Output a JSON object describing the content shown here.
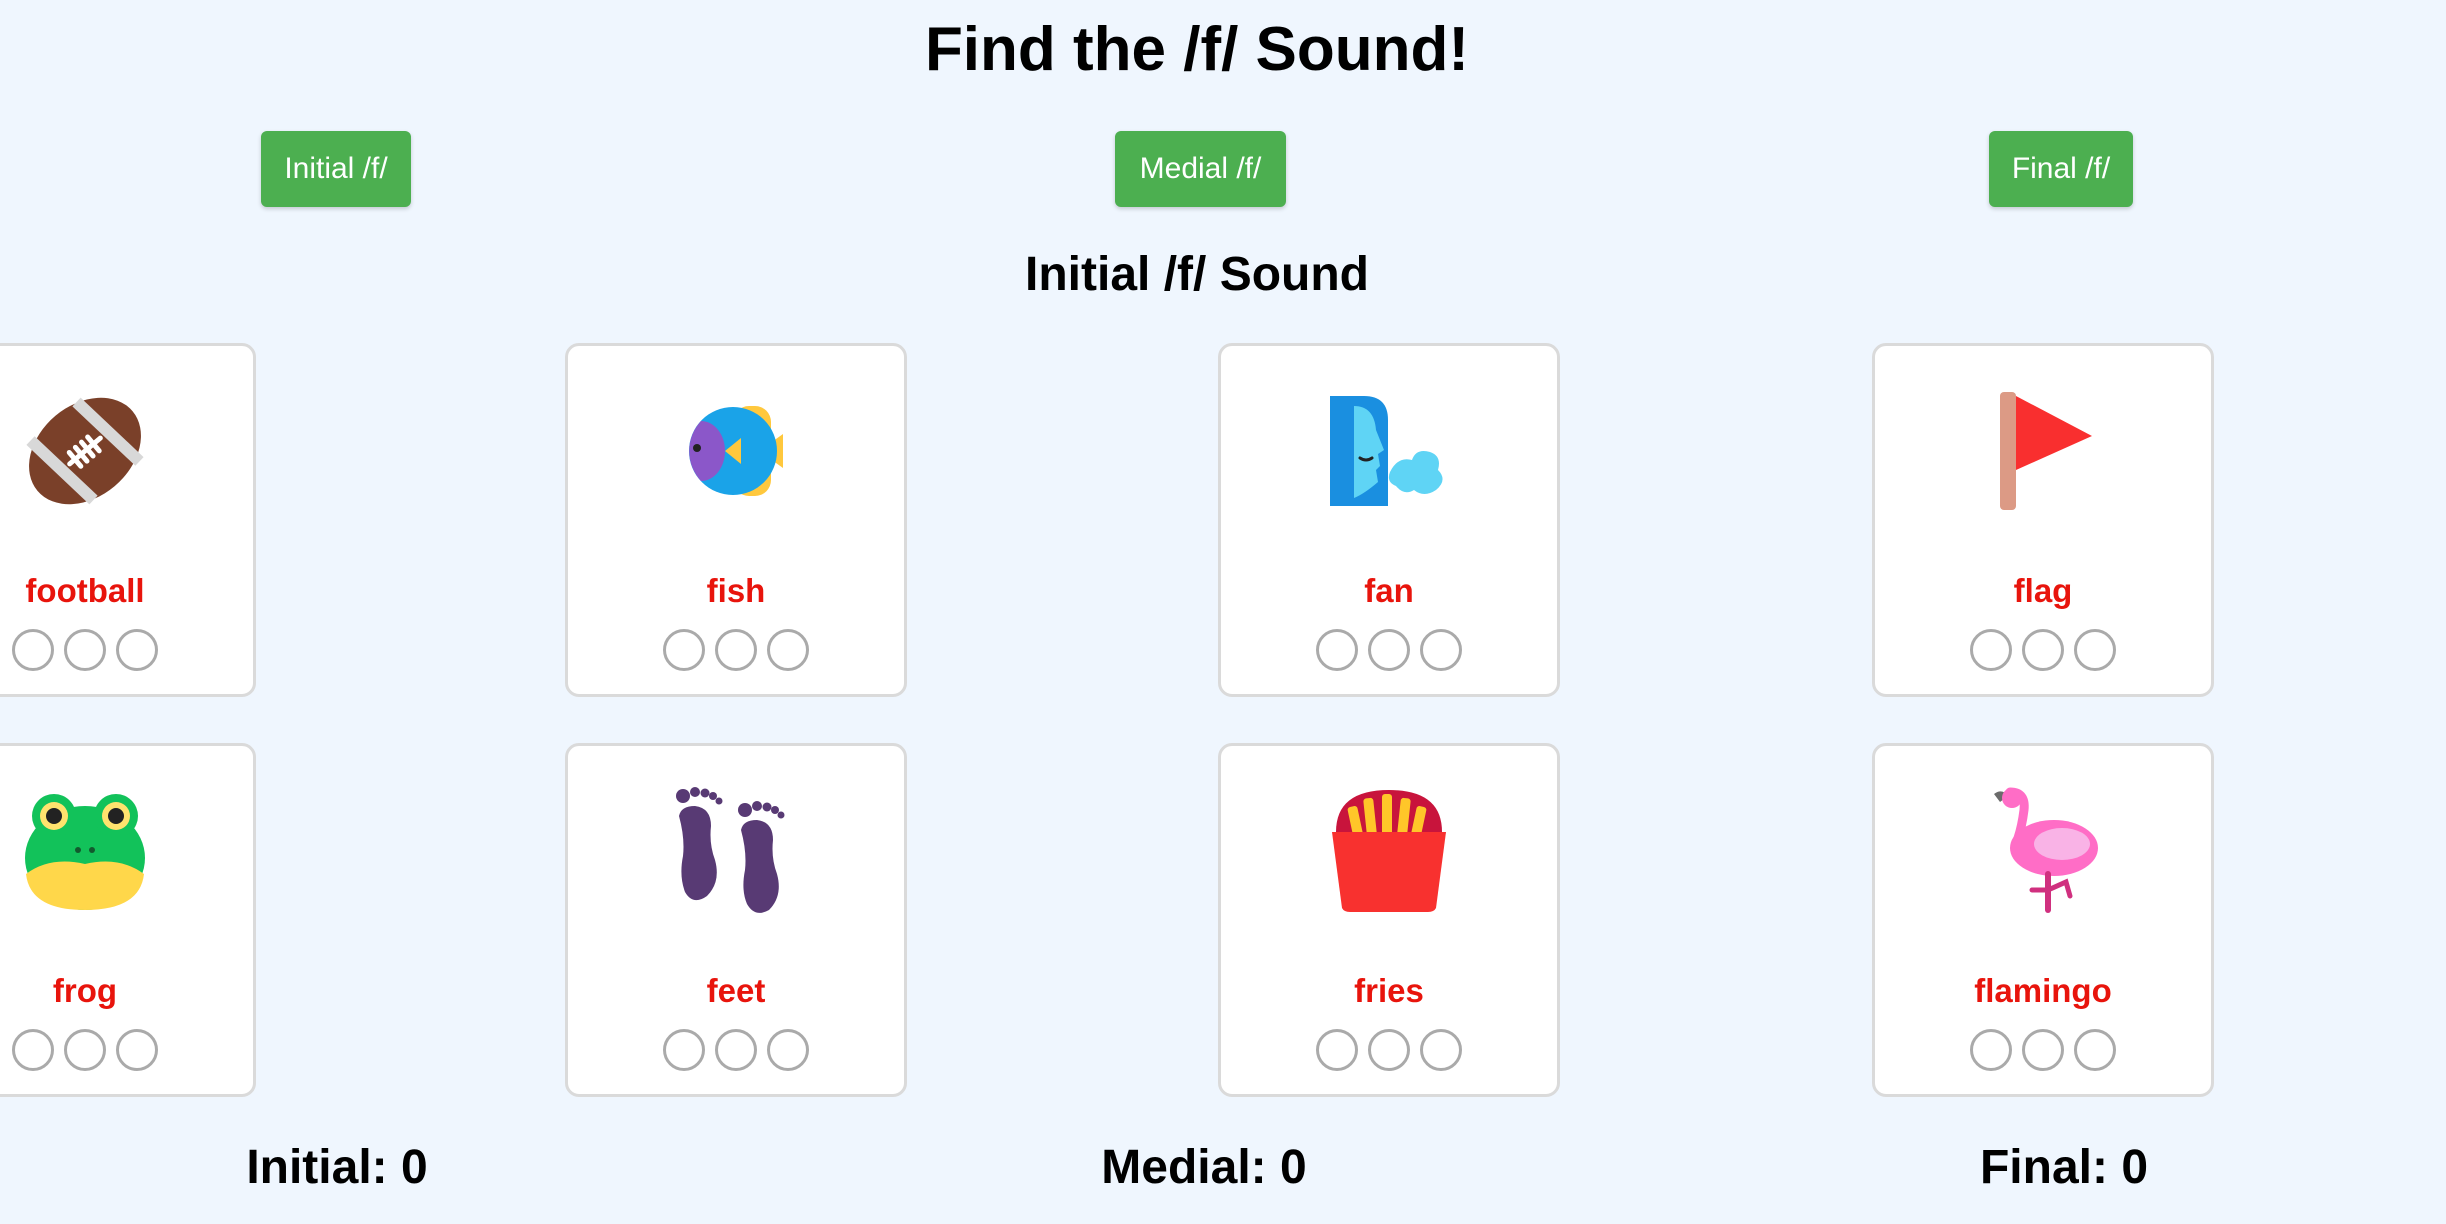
{
  "title": "Find the /f/ Sound!",
  "buttons": {
    "initial": "Initial /f/",
    "medial": "Medial /f/",
    "final": "Final /f/"
  },
  "section_title": "Initial /f/ Sound",
  "cards": [
    {
      "word": "football",
      "icon": "football-icon"
    },
    {
      "word": "fish",
      "icon": "fish-icon"
    },
    {
      "word": "fan",
      "icon": "fan-blowing-face-icon"
    },
    {
      "word": "flag",
      "icon": "flag-icon"
    },
    {
      "word": "frog",
      "icon": "frog-icon"
    },
    {
      "word": "feet",
      "icon": "footprints-icon"
    },
    {
      "word": "fries",
      "icon": "fries-icon"
    },
    {
      "word": "flamingo",
      "icon": "flamingo-icon"
    }
  ],
  "scores": {
    "initial": "Initial: 0",
    "medial": "Medial: 0",
    "final": "Final: 0"
  },
  "colors": {
    "background": "#eff6fe",
    "button": "#4caf50",
    "word": "#e8140c"
  }
}
